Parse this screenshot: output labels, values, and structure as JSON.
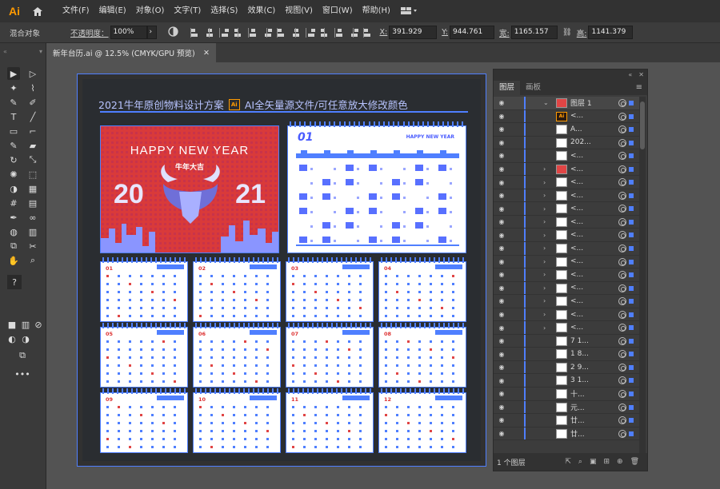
{
  "app": {
    "logo": "Ai",
    "accent": "#ff9a00"
  },
  "menu": [
    "文件(F)",
    "编辑(E)",
    "对象(O)",
    "文字(T)",
    "选择(S)",
    "效果(C)",
    "视图(V)",
    "窗口(W)",
    "帮助(H)"
  ],
  "control": {
    "mode_label": "混合对象",
    "opacity_label": "不透明度：",
    "opacity_value": "100%",
    "x_label": "X:",
    "x_value": "391.929",
    "y_label": "Y:",
    "y_value": "944.761",
    "w_label": "宽:",
    "w_value": "1165.157",
    "h_label": "高:",
    "h_value": "1141.379"
  },
  "document_tab": {
    "title": "新年台历.ai @ 12.5% (CMYK/GPU 预览)",
    "close": "✕"
  },
  "artboard": {
    "banner_left": "2021牛年原创物料设计方案",
    "banner_badge": "Ai",
    "banner_right": "AI全矢量源文件/可任意放大修改颜色",
    "cover_title": "HAPPY NEW YEAR",
    "cover_sub": "牛年大吉",
    "cover_num_left": "20",
    "cover_num_right": "21",
    "main_month": "01",
    "main_tag": "HAPPY NEW YEAR",
    "months": [
      "01",
      "02",
      "03",
      "04",
      "05",
      "06",
      "07",
      "08",
      "09",
      "10",
      "11",
      "12"
    ]
  },
  "layers_panel": {
    "tab_layers": "图层",
    "tab_artboards": "画板",
    "footer_count": "1 个图层",
    "rows": [
      {
        "name": "图层 1",
        "thumb": "red"
      },
      {
        "name": "<...",
        "thumb": "ai"
      },
      {
        "name": "A...",
        "thumb": "white"
      },
      {
        "name": "202...",
        "thumb": "white"
      },
      {
        "name": "<...",
        "thumb": "white"
      },
      {
        "name": "<...",
        "thumb": "red"
      },
      {
        "name": "<...",
        "thumb": "white"
      },
      {
        "name": "<...",
        "thumb": "white"
      },
      {
        "name": "<...",
        "thumb": "white"
      },
      {
        "name": "<...",
        "thumb": "white"
      },
      {
        "name": "<...",
        "thumb": "white"
      },
      {
        "name": "<...",
        "thumb": "white"
      },
      {
        "name": "<...",
        "thumb": "white"
      },
      {
        "name": "<...",
        "thumb": "white"
      },
      {
        "name": "<...",
        "thumb": "white"
      },
      {
        "name": "<...",
        "thumb": "white"
      },
      {
        "name": "<...",
        "thumb": "white"
      },
      {
        "name": "<...",
        "thumb": "white"
      },
      {
        "name": "7 1...",
        "thumb": "white"
      },
      {
        "name": "1 8...",
        "thumb": "white"
      },
      {
        "name": "2 9...",
        "thumb": "white"
      },
      {
        "name": "3 1...",
        "thumb": "white"
      },
      {
        "name": "十...",
        "thumb": "white"
      },
      {
        "name": "元...",
        "thumb": "white"
      },
      {
        "name": "廿...",
        "thumb": "white"
      },
      {
        "name": "廿...",
        "thumb": "white"
      }
    ]
  }
}
